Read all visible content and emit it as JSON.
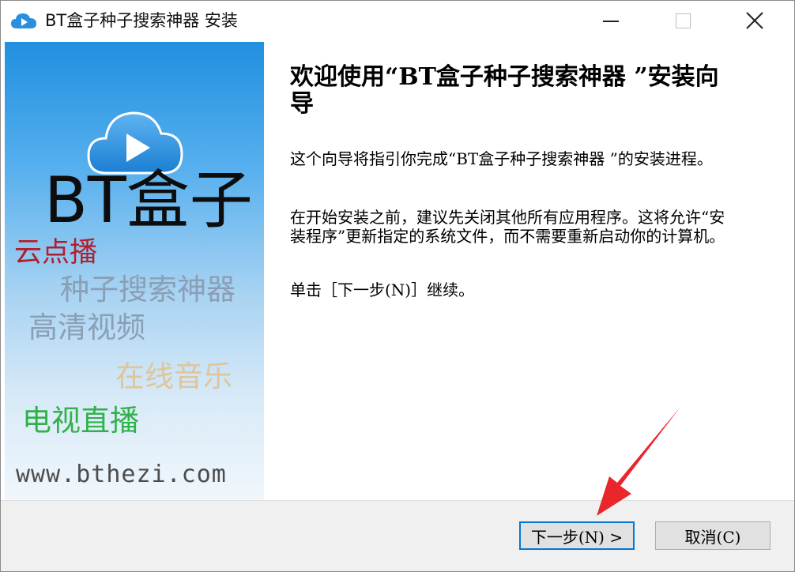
{
  "window": {
    "title": "BT盒子种子搜索神器 安装",
    "icon": "cloud-play-icon",
    "controls": [
      "minimize-icon",
      "maximize-icon",
      "close-icon"
    ]
  },
  "banner": {
    "logo": "cloud-play-icon",
    "brand": "BT盒子",
    "taglines": [
      "云点播",
      "种子搜索神器",
      "高清视频",
      "在线音乐",
      "电视直播"
    ],
    "url": "www.bthezi.com"
  },
  "content": {
    "heading": "欢迎使用“BT盒子种子搜索神器 ”安装向导",
    "paragraph1": "这个向导将指引你完成“BT盒子种子搜索神器 ”的安装进程。",
    "paragraph2": "在开始安装之前，建议先关闭其他所有应用程序。这将允许“安装程序”更新指定的系统文件，而不需要重新启动你的计算机。",
    "paragraph3": "单击［下一步(N)］继续。"
  },
  "footer": {
    "next_label": "下一步(N) >",
    "cancel_label": "取消(C)"
  },
  "colors": {
    "accent": "#0078d7",
    "annotation_arrow": "#e8262b",
    "tag_red": "#b21e2d",
    "tag_gray": "#8a9fb6",
    "tag_beige": "#e0c59a",
    "tag_green": "#32b04a"
  }
}
